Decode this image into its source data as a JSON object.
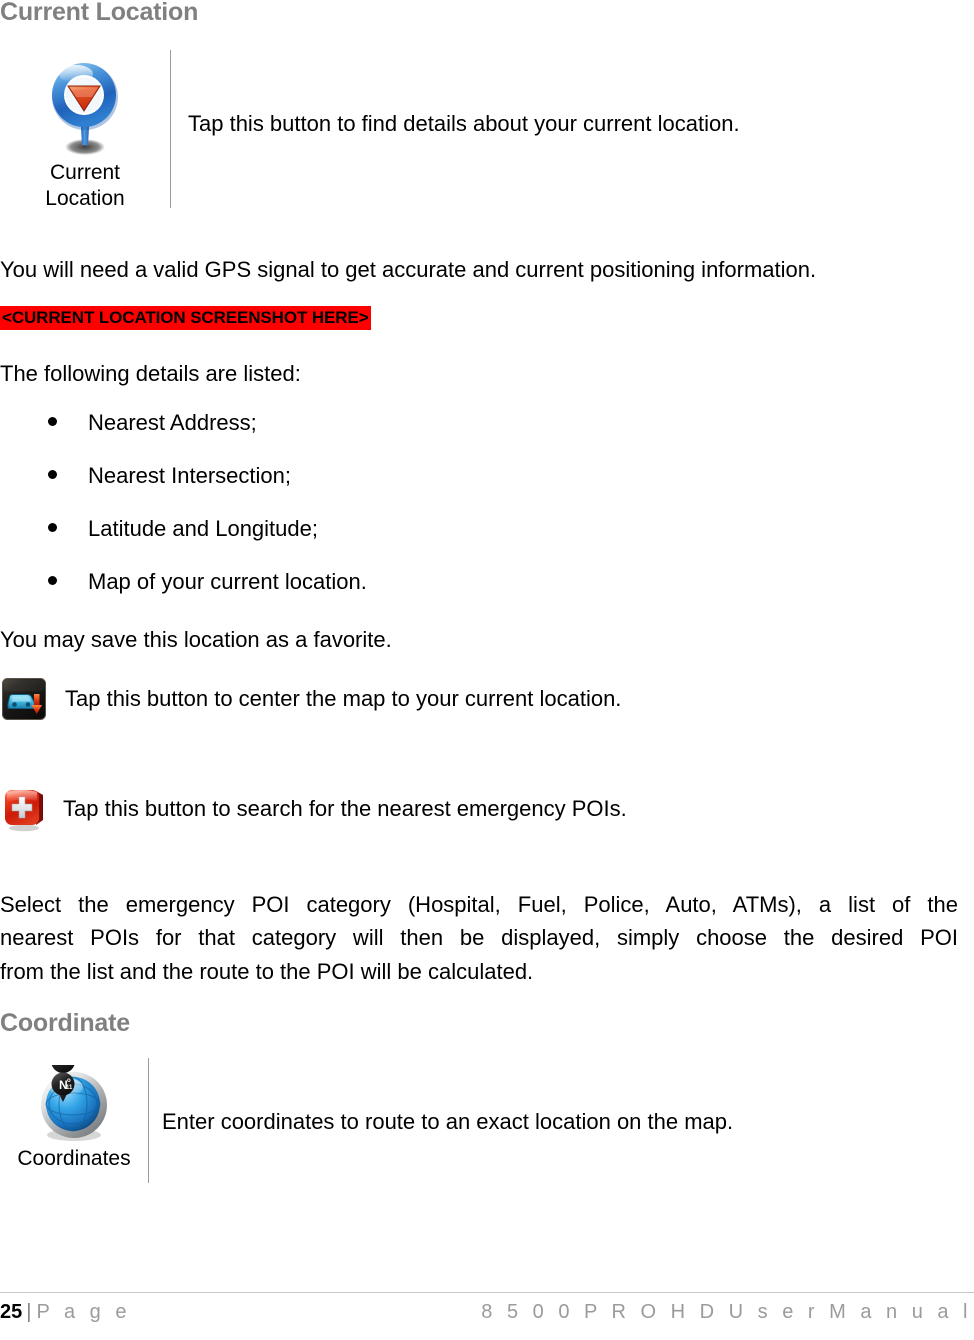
{
  "document": {
    "accent_heading_color": "#808080",
    "highlight_background_color": "#ff0000",
    "highlight_text_color": "#000000",
    "divider_color": "#9a9a9a"
  },
  "sections": {
    "current_location": {
      "heading": "Current Location",
      "icon_name": "current-location-pin-icon",
      "icon_caption": "Current\nLocation",
      "description": "Tap this button to find details about your current location."
    },
    "coordinate": {
      "heading": "Coordinate",
      "icon_name": "coordinates-globe-icon",
      "icon_caption": "Coordinates",
      "description": "Enter coordinates to route to an exact location on the map."
    }
  },
  "body": {
    "gps_note": "You will need a valid GPS signal to get accurate and current positioning information.",
    "screenshot_placeholder": "<CURRENT LOCATION SCREENSHOT HERE>",
    "following_details_intro": "The following details are listed:",
    "details_list": [
      "Nearest Address;",
      "Nearest Intersection;",
      "Latitude and Longitude;",
      "Map of your current location."
    ],
    "favorite_note": "You may save this location as a favorite.",
    "center_map_row": {
      "icon_name": "center-map-car-button-icon",
      "text": "Tap this button to center the map to your current location."
    },
    "emergency_poi_row": {
      "icon_name": "emergency-poi-cross-button-icon",
      "text": "Tap this button to search for the nearest emergency POIs."
    },
    "select_poi_paragraph": {
      "line1": "Select the emergency POI category (Hospital, Fuel, Police, Auto, ATMs), a list of the",
      "line2": "nearest POIs for that category will then be displayed, simply choose the desired POI",
      "line3": "from the list and the route to the POI will be calculated."
    }
  },
  "footer": {
    "page_number": "25",
    "separator": "|",
    "page_label": "P a g e",
    "manual_title": "8 5 0 0   P R O   H D   U s e r   M a n u a l"
  }
}
